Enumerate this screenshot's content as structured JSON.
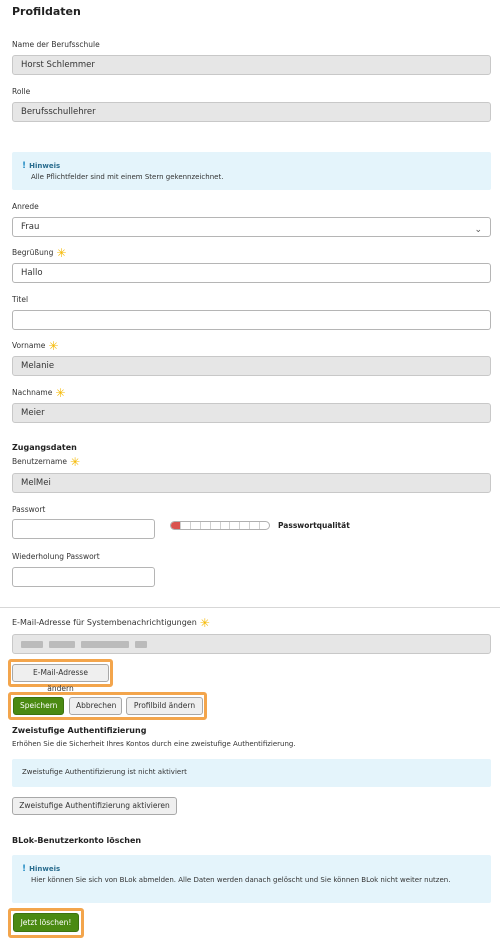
{
  "profile": {
    "heading": "Profildaten",
    "school_label": "Name der Berufsschule",
    "school_value": "Horst Schlemmer",
    "role_label": "Rolle",
    "role_value": "Berufsschullehrer",
    "hint1_title": "Hinweis",
    "hint1_text": "Alle Pflichtfelder sind mit einem Stern gekennzeichnet.",
    "salutation_label": "Anrede",
    "salutation_value": "Frau",
    "greeting_label": "Begrüßung",
    "greeting_value": "Hallo",
    "title_label": "Titel",
    "title_value": "",
    "firstname_label": "Vorname",
    "firstname_value": "Melanie",
    "lastname_label": "Nachname",
    "lastname_value": "Meier"
  },
  "access": {
    "heading": "Zugangsdaten",
    "username_label": "Benutzername",
    "username_value": "MelMei",
    "password_label": "Passwort",
    "password_quality_label": "Passwortqualität",
    "password_quality": 0.1,
    "repeat_label": "Wiederholung Passwort",
    "email_label": "E-Mail-Adresse für Systembenachrichtigungen",
    "change_email_button": "E-Mail-Adresse ändern"
  },
  "actions": {
    "save": "Speichern",
    "cancel": "Abbrechen",
    "change_picture": "Profilbild ändern"
  },
  "twofa": {
    "heading": "Zweistufige Authentifizierung",
    "description": "Erhöhen Sie die Sicherheit Ihres Kontos durch eine zweistufige Authentifizierung.",
    "status": "Zweistufige Authentifizierung ist nicht aktiviert",
    "activate_button": "Zweistufige Authentifizierung aktivieren"
  },
  "delete": {
    "heading": "BLok-Benutzerkonto löschen",
    "hint_title": "Hinweis",
    "hint_text": "Hier können Sie sich von BLok abmelden. Alle Daten werden danach gelöscht und Sie können BLok nicht weiter nutzen.",
    "button": "Jetzt löschen!"
  },
  "colors": {
    "accent_green": "#4b8a12",
    "highlight_orange": "#f3a54c",
    "required_star": "#f5b800",
    "hint_bg": "#e4f4fb"
  }
}
